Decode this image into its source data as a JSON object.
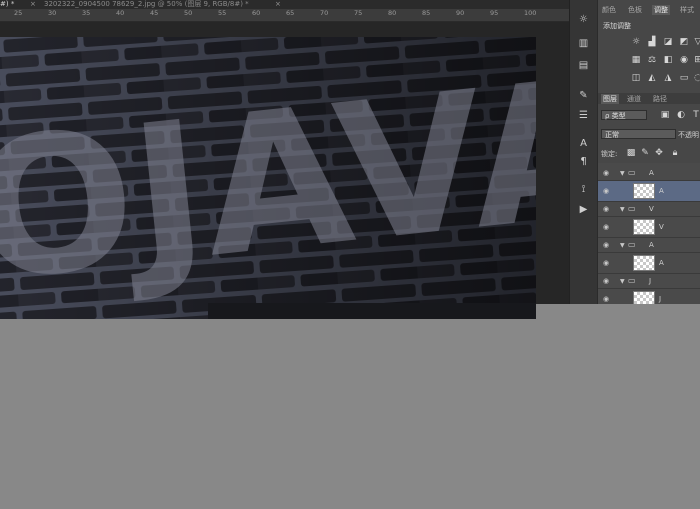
{
  "tabs": {
    "active_tab_label": "#) *",
    "inactive_tab_label": "3202322_0904500 78629_2.jpg @ 50% (图层 9, RGB/8#) *",
    "close_symbol": "×"
  },
  "ruler": {
    "labels": [
      "25",
      "30",
      "35",
      "40",
      "45",
      "50",
      "55",
      "60",
      "65",
      "70",
      "75",
      "80",
      "85",
      "90",
      "95",
      "100"
    ]
  },
  "canvas": {
    "image_text": "OJAVA"
  },
  "toolstrip": {
    "icons": [
      "sun-icon",
      "histogram-icon",
      "swatch-icon",
      "brush-icon",
      "sliders-icon",
      "text-a-icon",
      "paragraph-icon",
      "path-icon",
      "play-icon"
    ]
  },
  "panel": {
    "tabs": [
      "颜色",
      "色板",
      "调整",
      "样式"
    ],
    "adjustments_title": "添加调整",
    "layer_tabs": [
      "图层",
      "通道",
      "路径"
    ],
    "filter_label": "ρ 类型",
    "blend_mode": "正常",
    "opacity_label": "不透明",
    "lock_label": "锁定:",
    "layers": [
      {
        "type": "group",
        "name": "A"
      },
      {
        "type": "layer",
        "name": "A",
        "selected": true
      },
      {
        "type": "group",
        "name": "V"
      },
      {
        "type": "layer",
        "name": "V"
      },
      {
        "type": "group",
        "name": "A"
      },
      {
        "type": "layer",
        "name": "A"
      },
      {
        "type": "group",
        "name": "J"
      },
      {
        "type": "layer",
        "name": "J"
      }
    ]
  },
  "colors": {
    "workspace": "#888888",
    "panel_bg": "#474747",
    "selected_row": "#5c6a85",
    "brick": "#2a2b33",
    "mortar": "#5a5f6e"
  }
}
